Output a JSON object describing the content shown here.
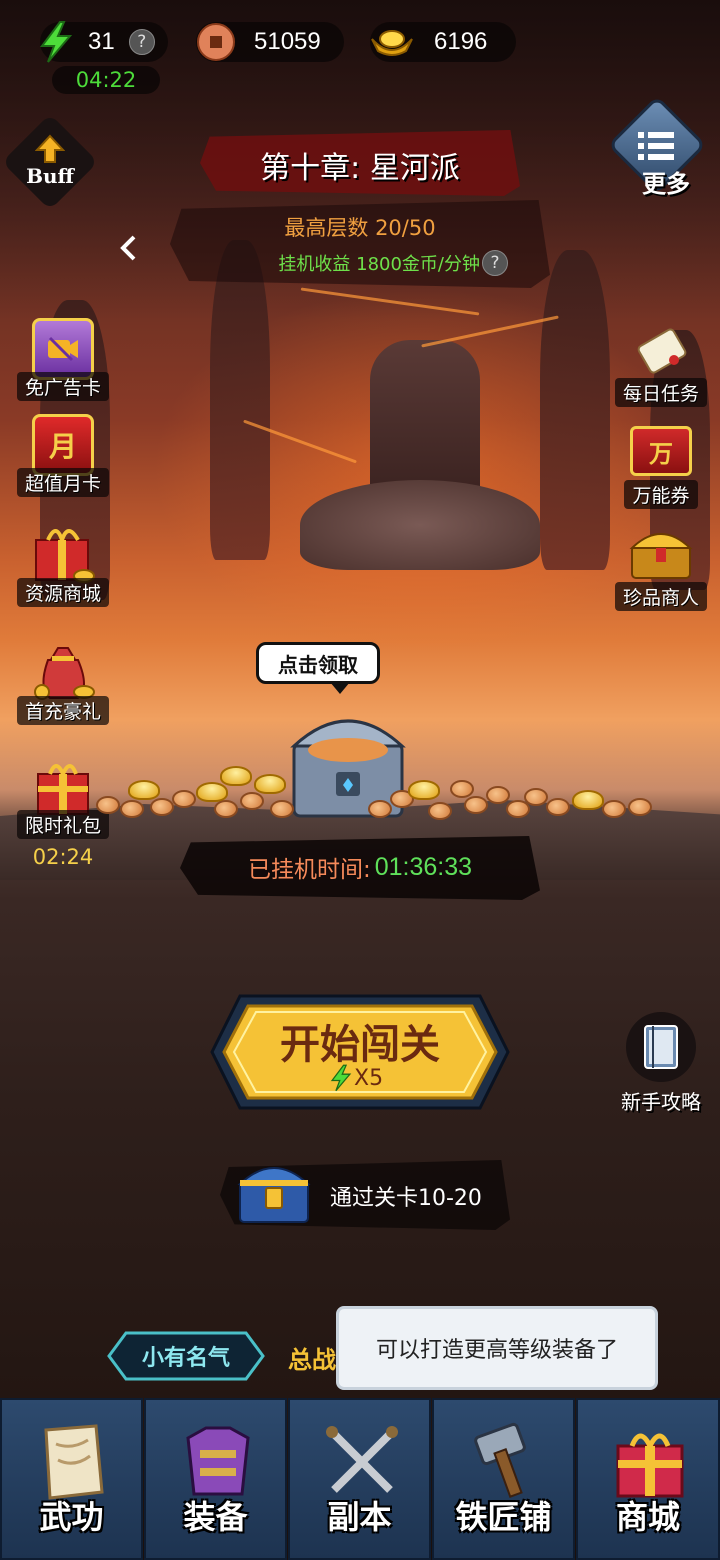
{
  "hud": {
    "energy": "31",
    "energy_timer": "04:22",
    "copper": "51059",
    "gold": "6196"
  },
  "header": {
    "buff_label": "Buff",
    "chapter_title": "第十章: 星河派",
    "highest_floor": "最高层数 20/50",
    "idle_income": "挂机收益 1800金币/分钟",
    "more_label": "更多"
  },
  "left_menu": [
    {
      "label": "免广告卡",
      "icon": "ad-free-card-icon"
    },
    {
      "label": "超值月卡",
      "icon": "monthly-card-icon",
      "badge": "月"
    },
    {
      "label": "资源商城",
      "icon": "resource-shop-icon"
    },
    {
      "label": "首充豪礼",
      "icon": "first-charge-gift-icon"
    },
    {
      "label": "限时礼包",
      "icon": "limited-gift-icon",
      "timer": "02:24"
    }
  ],
  "right_menu": [
    {
      "label": "每日任务",
      "icon": "daily-task-scroll-icon"
    },
    {
      "label": "万能券",
      "icon": "universal-ticket-icon",
      "badge": "万"
    },
    {
      "label": "珍品商人",
      "icon": "treasure-merchant-icon"
    }
  ],
  "treasure": {
    "bubble": "点击领取",
    "idle_time_label": "已挂机时间:",
    "idle_time_value": "01:36:33"
  },
  "start_button": {
    "label": "开始闯关",
    "cost": "X5"
  },
  "guide_label": "新手攻略",
  "reward": {
    "text": "通过关卡10-20"
  },
  "rank_badge": "小有名气",
  "power_label": "总战",
  "toast": "可以打造更高等级装备了",
  "bottom_nav": [
    {
      "label": "武功",
      "icon": "martial-arts-scroll-icon"
    },
    {
      "label": "装备",
      "icon": "armor-icon"
    },
    {
      "label": "副本",
      "icon": "crossed-swords-icon"
    },
    {
      "label": "铁匠铺",
      "icon": "hammer-icon"
    },
    {
      "label": "商城",
      "icon": "gift-box-icon"
    }
  ],
  "colors": {
    "energy_green": "#4ddc3a",
    "floor_orange": "#f0a040",
    "income_green": "#6ee04a",
    "time_green": "#5fe05a",
    "start_gold": "#f5c236",
    "nav_blue": "#2d4a6e"
  }
}
